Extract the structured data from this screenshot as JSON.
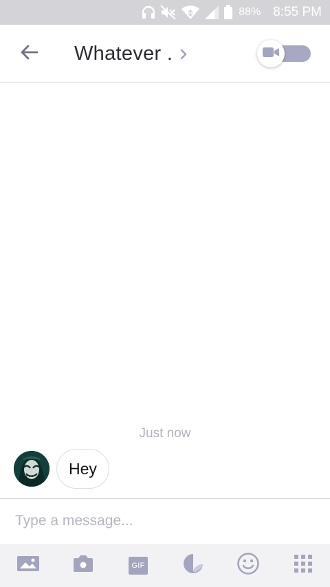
{
  "status_bar": {
    "battery_percent": "88%",
    "time": "8:55 PM",
    "icons": [
      "headphones-icon",
      "mute-icon",
      "wifi-icon",
      "signal-icon",
      "battery-icon"
    ]
  },
  "header": {
    "title": "Whatever .",
    "back_icon": "arrow-left-icon",
    "chevron_icon": "chevron-right-icon",
    "video_toggle_icon": "video-camera-icon",
    "video_toggle_on": false
  },
  "conversation": {
    "timestamp": "Just now",
    "messages": [
      {
        "text": "Hey",
        "from": "contact"
      }
    ]
  },
  "composer": {
    "placeholder": "Type a message..."
  },
  "toolbar": {
    "items": [
      {
        "name": "gallery-icon"
      },
      {
        "name": "camera-icon"
      },
      {
        "name": "gif-icon",
        "label": "GIF"
      },
      {
        "name": "sticker-icon"
      },
      {
        "name": "emoji-icon"
      },
      {
        "name": "apps-grid-icon"
      }
    ]
  },
  "colors": {
    "status_bar_bg": "#d4d4d8",
    "accent": "#a2a5bd",
    "title_text": "#2b2b33",
    "muted_text": "#b1b3bf"
  }
}
